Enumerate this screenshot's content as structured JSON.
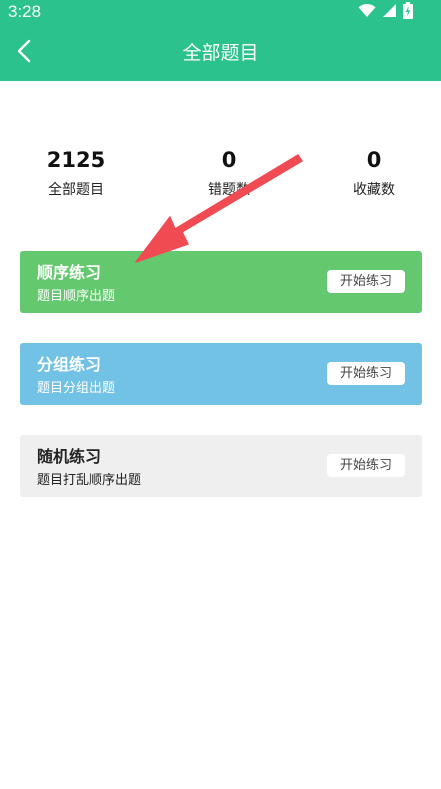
{
  "status_bar": {
    "time": "3:28",
    "icons": [
      "wifi-icon",
      "cellular-signal-icon",
      "battery-charging-icon"
    ]
  },
  "header": {
    "title": "全部题目",
    "back_icon": "chevron-left-icon"
  },
  "stats": [
    {
      "value": "2125",
      "label": "全部题目"
    },
    {
      "value": "0",
      "label": "错题数"
    },
    {
      "value": "0",
      "label": "收藏数"
    }
  ],
  "cards": [
    {
      "title": "顺序练习",
      "subtitle": "题目顺序出题",
      "button": "开始练习",
      "color": "#64c86e"
    },
    {
      "title": "分组练习",
      "subtitle": "题目分组出题",
      "button": "开始练习",
      "color": "#72c2e5"
    },
    {
      "title": "随机练习",
      "subtitle": "题目打乱顺序出题",
      "button": "开始练习",
      "color": "#efefef"
    }
  ],
  "colors": {
    "accent": "#2bc28e",
    "annotation_arrow": "#f04b52"
  }
}
